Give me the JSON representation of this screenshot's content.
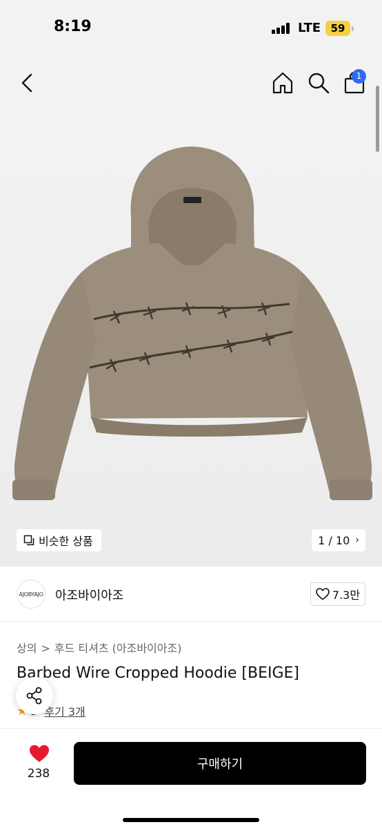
{
  "status_bar": {
    "time": "8:19",
    "network": "LTE",
    "battery": "59",
    "icons": [
      "signal-icon",
      "battery-icon"
    ]
  },
  "nav": {
    "icons": [
      "back-arrow-icon",
      "home-icon",
      "search-icon",
      "shopping-bag-icon"
    ],
    "cart_count": "1"
  },
  "gallery": {
    "image_name": "barbed-wire-cropped-hoodie-beige",
    "similar_label": "비슷한 상품",
    "similar_icon": "copy-icon",
    "pager": "1 / 10",
    "pager_icon": "chevron-right-icon",
    "current": 1,
    "total": 10
  },
  "brand": {
    "logo_text": "AJOBYAJO",
    "name": "아조바이아조",
    "likes": "7.3만",
    "like_icon": "heart-outline-icon"
  },
  "product": {
    "breadcrumb": [
      "상의",
      "후드 티셔츠 (아조바이아조)"
    ],
    "breadcrumb_separator": ">",
    "title": "Barbed Wire Cropped Hoodie [BEIGE]",
    "rating_value": "5",
    "review_link": "후기 3개",
    "star_icon": "star-icon",
    "share_icon": "share-icon"
  },
  "bottom_bar": {
    "like_count": "238",
    "heart_icon": "heart-filled-icon",
    "buy_label": "구매하기"
  },
  "colors": {
    "accent_blue": "#2f6bf0",
    "heart_red": "#e8192c",
    "star_orange": "#f3a21b",
    "battery_yellow": "#f5cf3f",
    "hoodie_beige": "#9c8e7c"
  }
}
